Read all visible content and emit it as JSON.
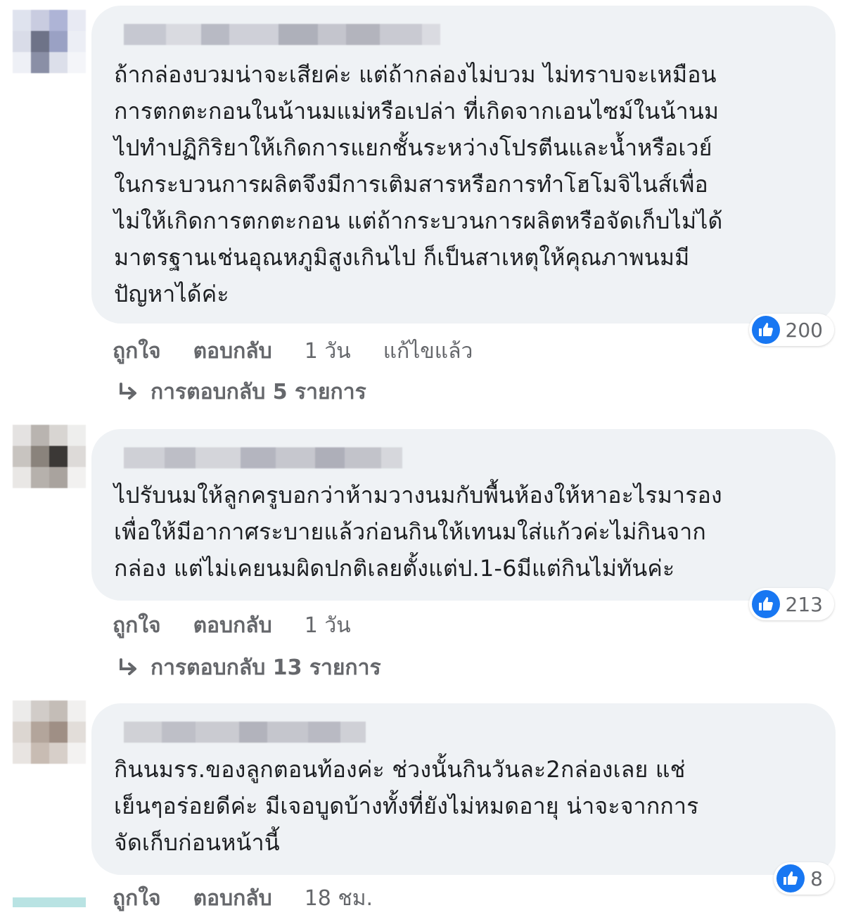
{
  "comments": [
    {
      "text": "ถ้ากล่องบวมน่าจะเสียค่ะ แต่ถ้ากล่องไม่บวม ไม่ทราบจะเหมือน\nการตกตะกอนในน้านมแม่หรือเปล่า ที่เกิดจากเอนไซม์ในน้านม\nไปทำปฏิกิริยาให้เกิดการแยกชั้นระหว่างโปรตีนและน้ำหรือเวย์\nในกระบวนการผลิตจึงมีการเติมสารหรือการทำโฮโมจิไนส์เพื่อ\nไม่ให้เกิดการตกตะกอน แต่ถ้ากระบวนการผลิตหรือจัดเก็บไม่ได้\nมาตรฐานเช่นอุณหภูมิสูงเกินไป ก็เป็นสาเหตุให้คุณภาพนมมี\nปัญหาได้ค่ะ",
      "reaction_count": "200",
      "like_label": "ถูกใจ",
      "reply_label": "ตอบกลับ",
      "time": "1 วัน",
      "edited": "แก้ไขแล้ว",
      "replies": "การตอบกลับ 5 รายการ"
    },
    {
      "text": "ไปรับนมให้ลูกครูบอกว่าห้ามวางนมกับพื้นห้องให้หาอะไรมารอง\nเพื่อให้มีอากาศระบายแล้วก่อนกินให้เทนมใส่แก้วค่ะไม่กินจาก\nกล่อง แต่ไม่เคยนมผิดปกติเลยตั้งแต่ป.1-6มีแต่กินไม่ทันค่ะ",
      "reaction_count": "213",
      "like_label": "ถูกใจ",
      "reply_label": "ตอบกลับ",
      "time": "1 วัน",
      "replies": "การตอบกลับ 13 รายการ"
    },
    {
      "text": "กินนมรร.ของลูกตอนท้องค่ะ ช่วงนั้นกินวันละ2กล่องเลย แช่\nเย็นๆอร่อยดีค่ะ มีเจอบูดบ้างทั้งที่ยังไม่หมดอายุ น่าจะจากการ\nจัดเก็บก่อนหน้านี้",
      "reaction_count": "8",
      "like_label": "ถูกใจ",
      "reply_label": "ตอบกลับ",
      "time": "18 ชม."
    }
  ],
  "icons": {
    "like": "thumbs-up-icon",
    "reply_arrow": "reply-arrow-icon"
  },
  "colors": {
    "bubble": "#eff2f5",
    "like_blue": "#1877f2",
    "meta_gray": "#65676b"
  }
}
